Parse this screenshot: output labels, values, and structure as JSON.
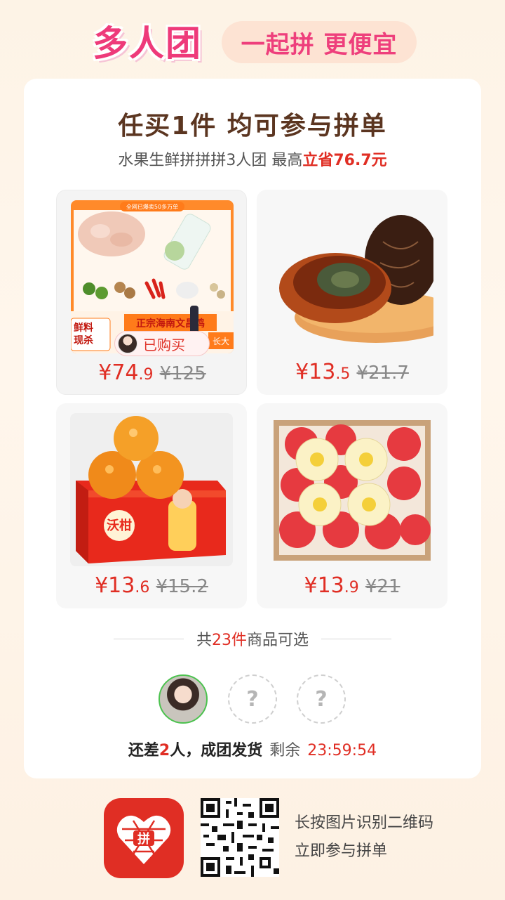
{
  "header": {
    "brand": "多人团",
    "slogan": "一起拼 更便宜"
  },
  "card": {
    "headline": "任买1件 均可参与拼单",
    "subline_prefix": "水果生鲜拼拼拼3人团 最高",
    "subline_save": "立省76.7元",
    "products": [
      {
        "price_yuan": "¥74",
        "price_dec": ".9",
        "original": "¥125",
        "bought_label": "已购买",
        "image_text": {
          "top_banner": "全网已爆卖50多万单",
          "bottom_banner": "正宗海南文昌鸡",
          "left_tag_1": "鲜料",
          "left_tag_2": "现杀",
          "right_tag": "长大"
        }
      },
      {
        "price_yuan": "¥13",
        "price_dec": ".5",
        "original": "¥21.7"
      },
      {
        "price_yuan": "¥13",
        "price_dec": ".6",
        "original": "¥15.2",
        "image_text": {
          "box_brand": "沃柑"
        }
      },
      {
        "price_yuan": "¥13",
        "price_dec": ".9",
        "original": "¥21"
      }
    ],
    "count_prefix": "共",
    "count_num": "23件",
    "count_suffix": "商品可选",
    "empty_slot": "?",
    "status_prefix": "还差",
    "status_num": "2",
    "status_suffix": "人，成团发货",
    "remaining_label": "剩余",
    "countdown": "23:59:54"
  },
  "footer": {
    "logo_text": "拼",
    "line1": "长按图片识别二维码",
    "line2": "立即参与拼单"
  },
  "colors": {
    "accent_red": "#e02e24",
    "brand_pink": "#ee3a7a",
    "headline_brown": "#5b3520"
  }
}
